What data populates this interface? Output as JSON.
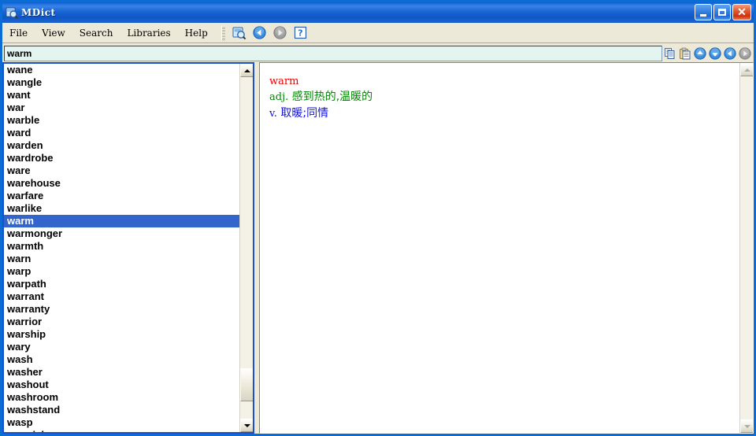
{
  "window": {
    "title": "MDict",
    "icon": "dictionary-magnifier-icon",
    "accent_color": "#1b50c8",
    "titlebar_color": "#0a60d2",
    "controls": {
      "minimize_label": "Minimize",
      "maximize_label": "Maximize",
      "close_label": "Close"
    }
  },
  "menubar": {
    "items": [
      {
        "label": "File",
        "name": "menu-file"
      },
      {
        "label": "View",
        "name": "menu-view"
      },
      {
        "label": "Search",
        "name": "menu-search"
      },
      {
        "label": "Libraries",
        "name": "menu-libraries"
      },
      {
        "label": "Help",
        "name": "menu-help"
      }
    ],
    "toolbar": [
      {
        "name": "lookup-icon",
        "title": "Lookup",
        "enabled": true
      },
      {
        "name": "back-arrow-icon",
        "title": "Back",
        "enabled": true
      },
      {
        "name": "forward-arrow-icon",
        "title": "Forward",
        "enabled": false
      },
      {
        "name": "help-icon",
        "title": "Help",
        "enabled": true
      }
    ]
  },
  "search": {
    "value": "warm",
    "placeholder": "",
    "background_color": "#e4f4ef",
    "buttons": [
      {
        "name": "copy-icon",
        "title": "Copy",
        "enabled": true
      },
      {
        "name": "paste-icon",
        "title": "Paste",
        "enabled": true
      },
      {
        "name": "scroll-up-icon",
        "title": "Previous",
        "enabled": true
      },
      {
        "name": "scroll-down-icon",
        "title": "Next",
        "enabled": true
      },
      {
        "name": "history-back-icon",
        "title": "Back",
        "enabled": true
      },
      {
        "name": "history-forward-icon",
        "title": "Forward",
        "enabled": false
      }
    ]
  },
  "word_list": {
    "selected": "warm",
    "selected_index": 12,
    "highlight_color": "#3366cc",
    "items": [
      "wane",
      "wangle",
      "want",
      "war",
      "warble",
      "ward",
      "warden",
      "wardrobe",
      "ware",
      "warehouse",
      "warfare",
      "warlike",
      "warm",
      "warmonger",
      "warmth",
      "warn",
      "warp",
      "warpath",
      "warrant",
      "warranty",
      "warrior",
      "warship",
      "wary",
      "wash",
      "washer",
      "washout",
      "washroom",
      "washstand",
      "wasp",
      "waspish"
    ]
  },
  "definition": {
    "headword": "warm",
    "headword_color": "#ee0000",
    "entries": [
      {
        "pos": "adj.",
        "text": "感到热的,温暖的",
        "color": "#008800"
      },
      {
        "pos": "v.",
        "text": "取暖;同情",
        "color": "#1111dd"
      }
    ]
  }
}
